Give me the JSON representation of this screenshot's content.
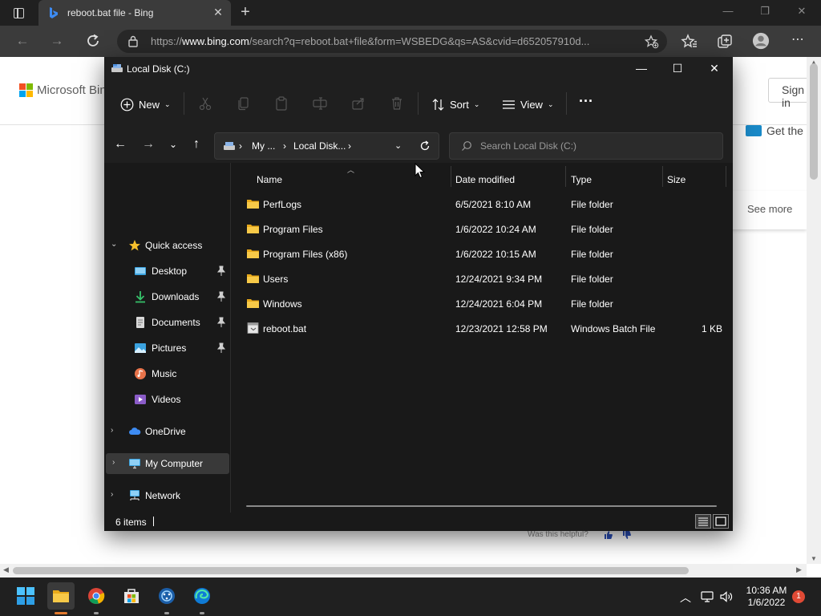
{
  "browser": {
    "tab_title": "reboot.bat file - Bing",
    "url_prefix": "https://",
    "url_domain": "www.bing.com",
    "url_rest": "/search?q=reboot.bat+file&form=WSBEDG&qs=AS&cvid=d652057910d..."
  },
  "bing": {
    "logo_text": "Microsoft Bing",
    "sign_in": "Sign in",
    "get_the": "Get the",
    "see_more": "See more",
    "helpful": "Was this helpful?"
  },
  "explorer": {
    "window_title": "Local Disk (C:)",
    "commands": {
      "new": "New",
      "sort": "Sort",
      "view": "View"
    },
    "breadcrumb": [
      "My ...",
      "Local Disk..."
    ],
    "search_placeholder": "Search Local Disk (C:)",
    "nav": {
      "quick_access": "Quick access",
      "desktop": "Desktop",
      "downloads": "Downloads",
      "documents": "Documents",
      "pictures": "Pictures",
      "music": "Music",
      "videos": "Videos",
      "onedrive": "OneDrive",
      "my_computer": "My Computer",
      "network": "Network"
    },
    "columns": {
      "name": "Name",
      "date": "Date modified",
      "type": "Type",
      "size": "Size"
    },
    "files": [
      {
        "name": "PerfLogs",
        "date": "6/5/2021 8:10 AM",
        "type": "File folder",
        "size": ""
      },
      {
        "name": "Program Files",
        "date": "1/6/2022 10:24 AM",
        "type": "File folder",
        "size": ""
      },
      {
        "name": "Program Files (x86)",
        "date": "1/6/2022 10:15 AM",
        "type": "File folder",
        "size": ""
      },
      {
        "name": "Users",
        "date": "12/24/2021 9:34 PM",
        "type": "File folder",
        "size": ""
      },
      {
        "name": "Windows",
        "date": "12/24/2021 6:04 PM",
        "type": "File folder",
        "size": ""
      },
      {
        "name": "reboot.bat",
        "date": "12/23/2021 12:58 PM",
        "type": "Windows Batch File",
        "size": "1 KB"
      }
    ],
    "status_count": "6 items"
  },
  "taskbar": {
    "time": "10:36 AM",
    "date": "1/6/2022",
    "notifications": "1"
  },
  "colors": {
    "explorer_bg": "#191919",
    "folder_yellow": "#f4c542",
    "accent_blue": "#4cc2ff",
    "taskbar_bg": "#202020"
  }
}
